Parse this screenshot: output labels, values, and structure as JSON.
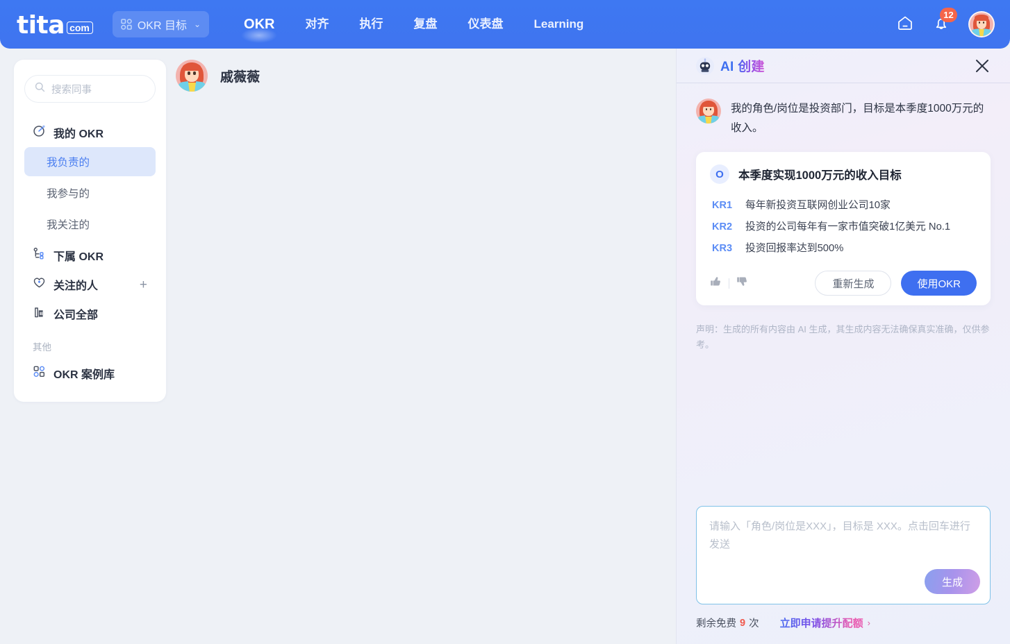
{
  "topnav": {
    "logo_main": "tita",
    "logo_domain": "com",
    "goal_chip": {
      "label": "OKR 目标",
      "icon": "grid-icon",
      "chevron": "chevron-down-icon"
    },
    "links": [
      {
        "label": "OKR",
        "active": true
      },
      {
        "label": "对齐",
        "active": false
      },
      {
        "label": "执行",
        "active": false
      },
      {
        "label": "复盘",
        "active": false
      },
      {
        "label": "仪表盘",
        "active": false
      },
      {
        "label": "Learning",
        "active": false
      }
    ],
    "home_icon": "home-icon",
    "bell_icon": "bell-icon",
    "notification_count": "12",
    "avatar": "user-avatar"
  },
  "sidebar": {
    "search_placeholder": "搜索同事",
    "search_icon": "search-icon",
    "my_okr": {
      "label": "我的 OKR",
      "icon": "target-icon"
    },
    "my_okr_children": [
      {
        "label": "我负责的",
        "active": true
      },
      {
        "label": "我参与的",
        "active": false
      },
      {
        "label": "我关注的",
        "active": false
      }
    ],
    "sub_okr": {
      "label": "下属 OKR",
      "icon": "org-tree-icon"
    },
    "followed": {
      "label": "关注的人",
      "icon": "heart-icon",
      "add": "+"
    },
    "company": {
      "label": "公司全部",
      "icon": "building-icon"
    },
    "other_label": "其他",
    "case_library": {
      "label": "OKR 案例库",
      "icon": "grid-icon"
    }
  },
  "main": {
    "user_name": "戚薇薇",
    "avatar": "user-avatar"
  },
  "ai_panel": {
    "title_prefix": "AI ",
    "title_suffix": "创建",
    "robot_icon": "robot-icon",
    "close_icon": "close-icon",
    "user_message": "我的角色/岗位是投资部门，目标是本季度1000万元的收入。",
    "objective": {
      "badge": "O",
      "text": "本季度实现1000万元的收入目标"
    },
    "key_results": [
      {
        "tag": "KR1",
        "text": "每年新投资互联网创业公司10家"
      },
      {
        "tag": "KR2",
        "text": "投资的公司每年有一家市值突破1亿美元 No.1"
      },
      {
        "tag": "KR3",
        "text": "投资回报率达到500%"
      }
    ],
    "thumbs_up_icon": "thumbs-up-icon",
    "thumbs_down_icon": "thumbs-down-icon",
    "regenerate_label": "重新生成",
    "use_okr_label": "使用OKR",
    "disclaimer": "声明：生成的所有内容由 AI 生成，其生成内容无法确保真实准确，仅供参考。",
    "composer_placeholder": "请输入「角色/岗位是XXX」，目标是 XXX。点击回车进行发送",
    "composer_value": "",
    "generate_label": "生成",
    "quota_prefix": "剩余免费",
    "quota_count": "9",
    "quota_suffix": "次",
    "quota_link": "立即申请提升配额",
    "quota_arrow": "›"
  },
  "colors": {
    "brand_blue": "#3e6ff0",
    "nav_bg": "#3f74ef",
    "badge_red": "#f5654a",
    "active_item_bg": "#dde7fb",
    "page_bg": "#eef1f6"
  }
}
